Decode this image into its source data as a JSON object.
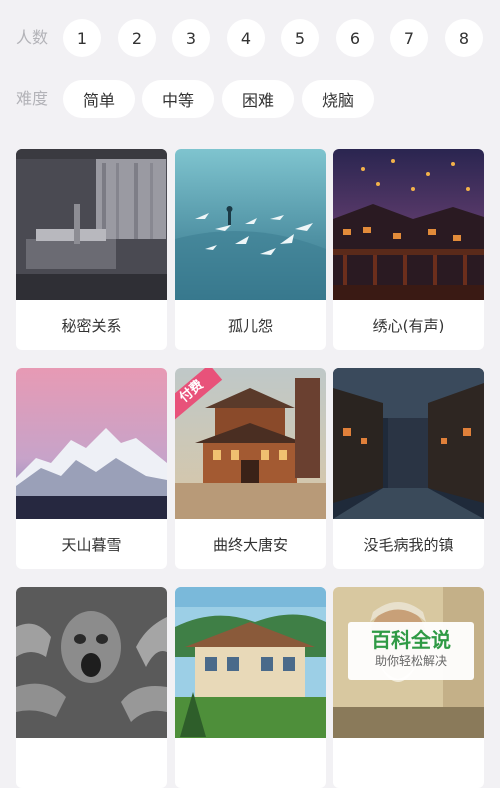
{
  "filters": {
    "players_label": "人数",
    "player_options": [
      "1",
      "2",
      "3",
      "4",
      "5",
      "6",
      "7",
      "8"
    ],
    "difficulty_label": "难度",
    "difficulty_options": [
      "简单",
      "中等",
      "困难",
      "烧脑"
    ]
  },
  "cards": [
    {
      "title": "秘密关系",
      "image": "hospital-room-image"
    },
    {
      "title": "孤儿怨",
      "image": "birds-over-sea-image"
    },
    {
      "title": "绣心(有声)",
      "image": "night-lantern-town-image"
    },
    {
      "title": "天山暮雪",
      "image": "snow-mountains-image"
    },
    {
      "title": "曲终大唐安",
      "image": "tang-palace-image",
      "badge": "付费"
    },
    {
      "title": "没毛病我的镇",
      "image": "night-old-street-image"
    },
    {
      "title": "",
      "image": "zombie-hands-image"
    },
    {
      "title": "",
      "image": "villa-garden-image"
    },
    {
      "title": "",
      "image": "bearded-scholar-image"
    }
  ],
  "watermark": {
    "title": "百科全说",
    "subtitle": "助你轻松解决"
  },
  "colors": {
    "background": "#f2f1f4",
    "pill": "#ffffff",
    "badge": "#e8527a",
    "watermark_green": "#2f9a45"
  }
}
